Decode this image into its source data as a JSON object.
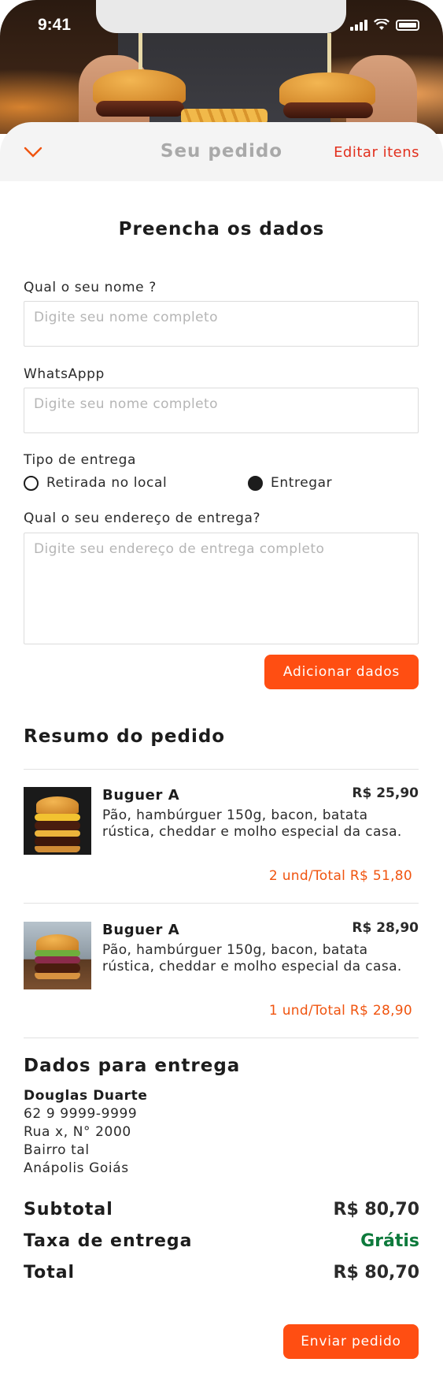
{
  "status_bar": {
    "time": "9:41"
  },
  "header": {
    "title": "Seu pedido",
    "edit_label": "Editar itens"
  },
  "form": {
    "title": "Preencha os dados",
    "name_label": "Qual o seu nome ?",
    "name_placeholder": "Digite seu nome completo",
    "whatsapp_label": "WhatsAppp",
    "whatsapp_placeholder": "Digite seu nome completo",
    "delivery_type_label": "Tipo de entrega",
    "delivery_options": [
      {
        "label": "Retirada no local",
        "selected": false
      },
      {
        "label": "Entregar",
        "selected": true
      }
    ],
    "address_label": "Qual o seu endereço de entrega?",
    "address_placeholder": "Digite seu endereço de entrega completo",
    "add_button": "Adicionar dados"
  },
  "summary": {
    "title": "Resumo do pedido",
    "items": [
      {
        "name": "Buguer A",
        "price": "R$ 25,90",
        "description": "Pão, hambúrguer 150g, bacon, batata rústica, cheddar e molho especial da casa.",
        "total": "2 und/Total R$ 51,80"
      },
      {
        "name": "Buguer A",
        "price": "R$ 28,90",
        "description": "Pão, hambúrguer 150g, bacon, batata rústica, cheddar e molho especial da casa.",
        "total": "1 und/Total R$ 28,90"
      }
    ]
  },
  "delivery": {
    "title": "Dados para entrega",
    "name": "Douglas Duarte",
    "phone": "62 9 9999-9999",
    "street": "Rua x, N° 2000",
    "district": "Bairro tal",
    "city": "Anápolis Goiás"
  },
  "totals": {
    "subtotal_label": "Subtotal",
    "subtotal_value": "R$ 80,70",
    "fee_label": "Taxa de entrega",
    "fee_value": "Grátis",
    "total_label": "Total",
    "total_value": "R$ 80,70"
  },
  "submit_button": "Enviar pedido",
  "colors": {
    "accent": "#ff4e12",
    "link": "#e2301e",
    "free": "#0e7a3c"
  }
}
